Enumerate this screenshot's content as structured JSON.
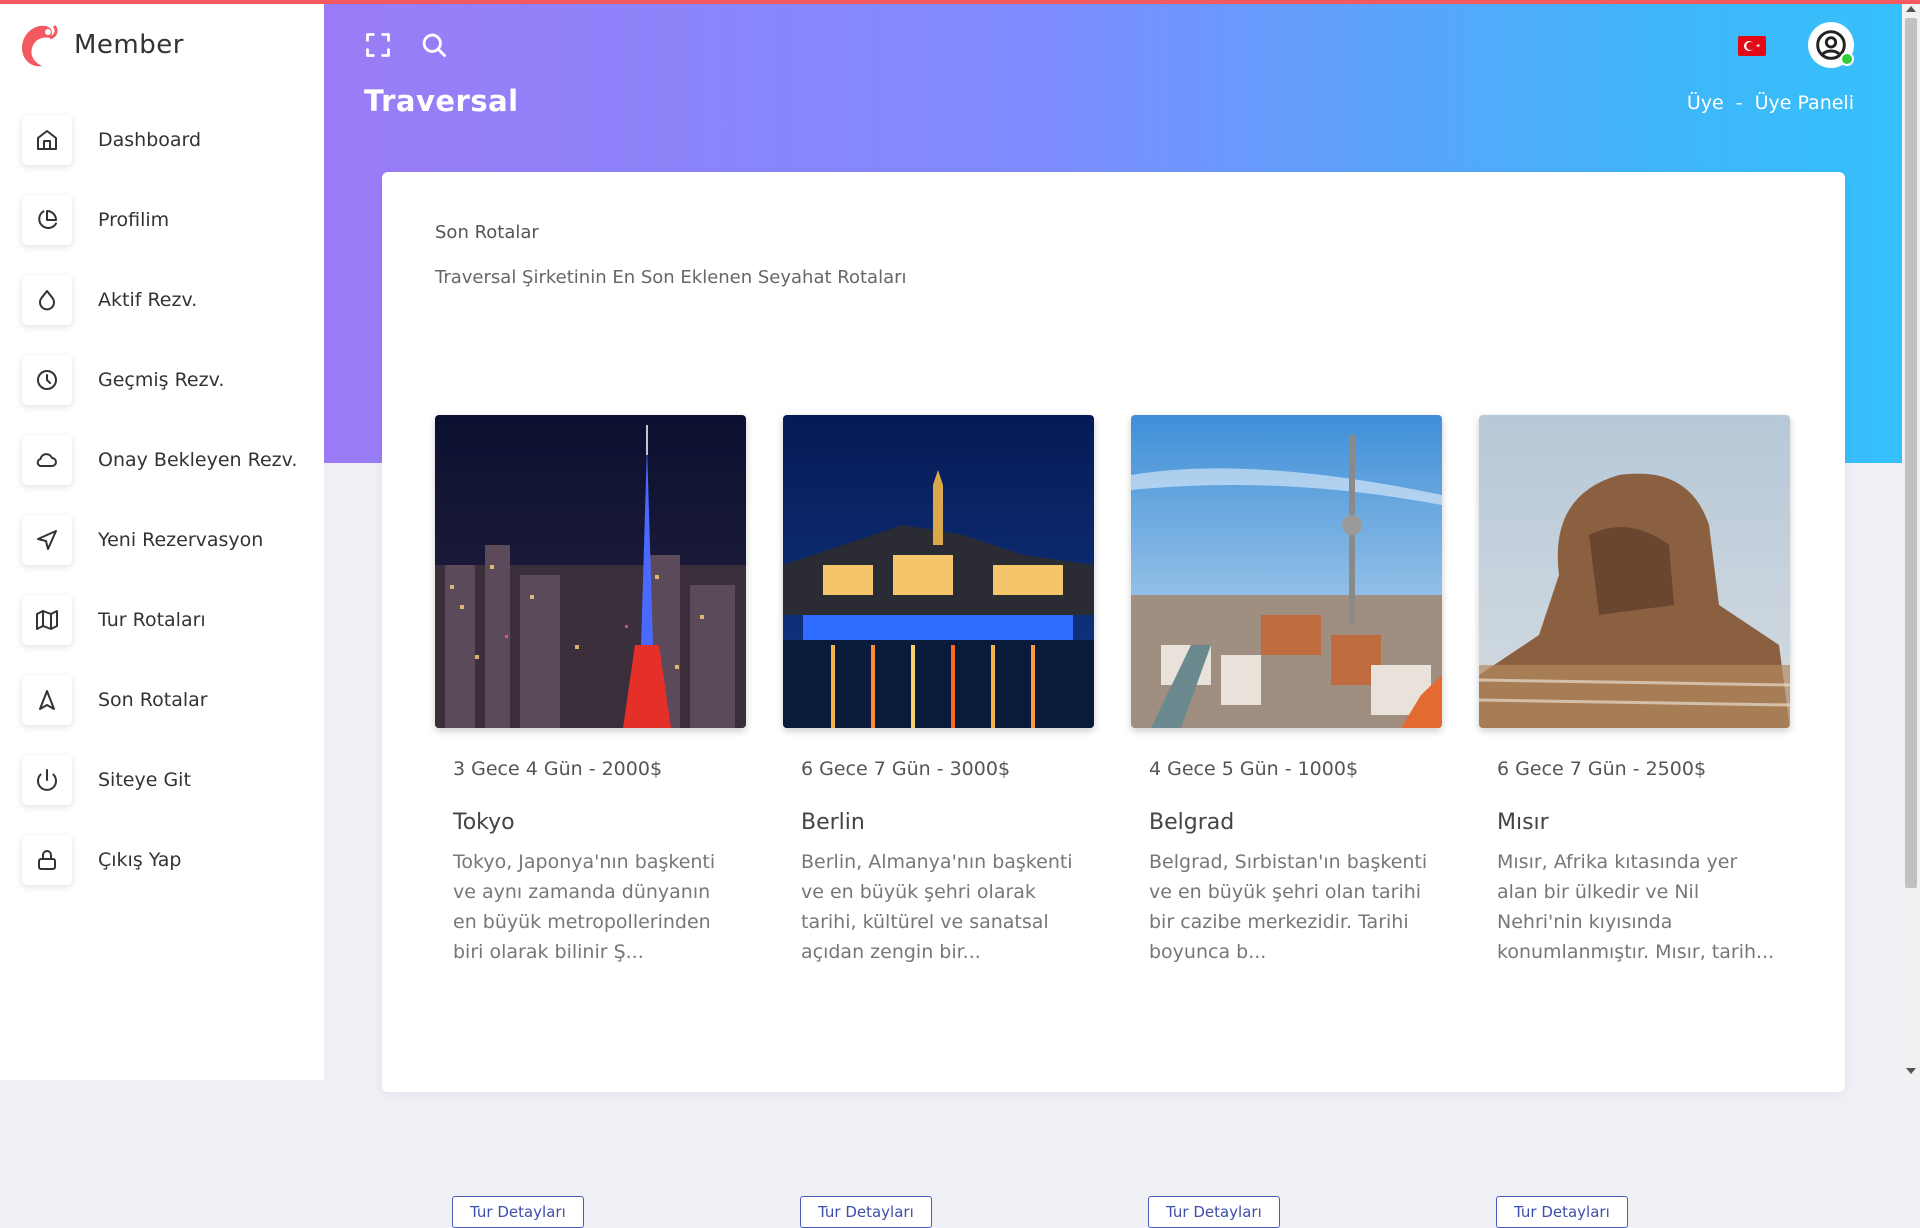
{
  "app": {
    "brand": "Member"
  },
  "sidebar": {
    "items": [
      {
        "label": "Dashboard",
        "icon": "home-icon"
      },
      {
        "label": "Profilim",
        "icon": "pie-chart-icon"
      },
      {
        "label": "Aktif Rezv.",
        "icon": "droplet-icon"
      },
      {
        "label": "Geçmiş Rezv.",
        "icon": "clock-icon"
      },
      {
        "label": "Onay Bekleyen Rezv.",
        "icon": "cloud-icon"
      },
      {
        "label": "Yeni Rezervasyon",
        "icon": "navigation-icon"
      },
      {
        "label": "Tur Rotaları",
        "icon": "map-icon"
      },
      {
        "label": "Son Rotalar",
        "icon": "navigation-arrow-icon"
      },
      {
        "label": "Siteye Git",
        "icon": "power-icon"
      },
      {
        "label": "Çıkış Yap",
        "icon": "lock-icon"
      }
    ]
  },
  "header": {
    "title": "Traversal",
    "breadcrumb": [
      "Üye",
      "-",
      "Üye Paneli"
    ],
    "language_flag": "turkey-flag-icon",
    "colors": {
      "gradient_start": "#9b7cf6",
      "gradient_end": "#35c0fb",
      "top_line": "#f25961"
    }
  },
  "main": {
    "card_title": "Son Rotalar",
    "card_subtitle": "Traversal Şirketinin En Son Eklenen Seyahat Rotaları",
    "tours": [
      {
        "meta": "3 Gece 4 Gün - 2000$",
        "name": "Tokyo",
        "description": "Tokyo, Japonya'nın başkenti ve aynı zamanda dünyanın en büyük metropollerinden biri olarak bilinir Ş...",
        "button": "Tur Detayları",
        "image": "tokyo-night-skyline-image"
      },
      {
        "meta": "6 Gece 7 Gün - 3000$",
        "name": "Berlin",
        "description": "Berlin, Almanya'nın başkenti ve en büyük şehri olarak tarihi, kültürel ve sanatsal açıdan zengin bir...",
        "button": "Tur Detayları",
        "image": "river-night-city-image"
      },
      {
        "meta": "4 Gece 5 Gün - 1000$",
        "name": "Belgrad",
        "description": "Belgrad, Sırbistan'ın başkenti ve en büyük şehri olan tarihi bir cazibe merkezidir. Tarihi boyunca b...",
        "button": "Tur Detayları",
        "image": "berlin-tv-tower-image"
      },
      {
        "meta": "6 Gece 7 Gün - 2500$",
        "name": "Mısır",
        "description": "Mısır, Afrika kıtasında yer alan bir ülkedir ve Nil Nehri'nin kıyısında konumlanmıştır. Mısır, tarih...",
        "button": "Tur Detayları",
        "image": "sphinx-image"
      }
    ]
  }
}
